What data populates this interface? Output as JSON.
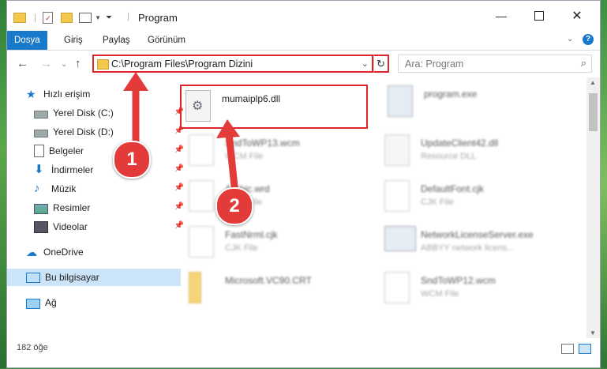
{
  "window": {
    "title": "Program"
  },
  "ribbon": {
    "tabs": [
      "Dosya",
      "Giriş",
      "Paylaş",
      "Görünüm"
    ]
  },
  "address": {
    "path": "C:\\Program Files\\Program Dizini",
    "search_placeholder": "Ara: Program"
  },
  "sidebar": {
    "items": [
      {
        "label": "Hızlı erişim",
        "icon": "star-icon"
      },
      {
        "label": "Yerel Disk (C:)",
        "icon": "drive-icon"
      },
      {
        "label": "Yerel Disk (D:)",
        "icon": "drive-icon"
      },
      {
        "label": "Belgeler",
        "icon": "document-icon"
      },
      {
        "label": "İndirmeler",
        "icon": "download-icon"
      },
      {
        "label": "Müzik",
        "icon": "music-icon"
      },
      {
        "label": "Resimler",
        "icon": "pictures-icon"
      },
      {
        "label": "Videolar",
        "icon": "video-icon"
      },
      {
        "label": "OneDrive",
        "icon": "cloud-icon"
      },
      {
        "label": "Bu bilgisayar",
        "icon": "computer-icon"
      },
      {
        "label": "Ağ",
        "icon": "network-icon"
      }
    ]
  },
  "files": [
    {
      "name": "mumaiplp6.dll",
      "type": ""
    },
    {
      "name": "program.exe",
      "type": ""
    },
    {
      "name": "SndToWP13.wcm",
      "type": "WCM File"
    },
    {
      "name": "UpdateClient42.dll",
      "type": "Resource DLL"
    },
    {
      "name": "Arabic.wrd",
      "type": "WRD File"
    },
    {
      "name": "DefaultFont.cjk",
      "type": "CJK File"
    },
    {
      "name": "FastNrml.cjk",
      "type": "CJK File"
    },
    {
      "name": "NetworkLicenseServer.exe",
      "type": "ABBYY network licens..."
    },
    {
      "name": "Microsoft.VC90.CRT",
      "type": ""
    },
    {
      "name": "SndToWP12.wcm",
      "type": "WCM File"
    }
  ],
  "status": {
    "count": "182 öğe"
  },
  "callouts": [
    "1",
    "2"
  ],
  "colors": {
    "accent": "#1979ca",
    "highlight": "#e0242c",
    "callout": "#e33a3a"
  }
}
